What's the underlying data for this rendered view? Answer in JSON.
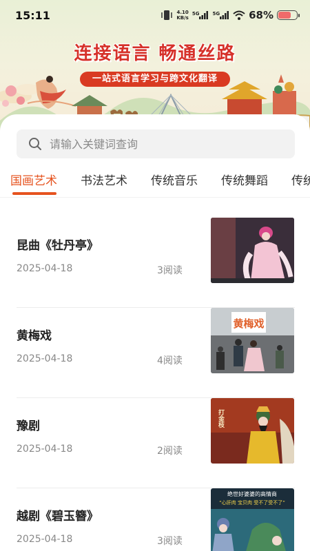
{
  "status_bar": {
    "time": "15:11",
    "net_speed_value": "4.10",
    "net_speed_unit": "KB/s",
    "signal_1_label": "5G",
    "signal_2_label": "5G",
    "battery_percent": "68%",
    "battery_level": 0.68,
    "battery_color": "#f06a6a"
  },
  "banner": {
    "slogan": "连接语言 畅通丝路",
    "subtitle": "一站式语言学习与跨文化翻译"
  },
  "search": {
    "placeholder": "请输入关键词查询"
  },
  "tabs": [
    {
      "label": "国画艺术",
      "active": true
    },
    {
      "label": "书法艺术",
      "active": false
    },
    {
      "label": "传统音乐",
      "active": false
    },
    {
      "label": "传统舞蹈",
      "active": false
    },
    {
      "label": "传统",
      "active": false
    }
  ],
  "articles": [
    {
      "title": "昆曲《牡丹亭》",
      "date": "2025-04-18",
      "reads": "3阅读"
    },
    {
      "title": "黄梅戏",
      "date": "2025-04-18",
      "reads": "4阅读"
    },
    {
      "title": "豫剧",
      "date": "2025-04-18",
      "reads": "2阅读"
    },
    {
      "title": "越剧《碧玉簪》",
      "date": "2025-04-18",
      "reads": "3阅读"
    }
  ],
  "thumbnail_text": {
    "huangmeixi_sign": "黄梅戏",
    "yuju_sign": "打金枝",
    "yueju_caption_1": "绝世好婆婆的高情商",
    "yueju_caption_2": "“心肝肉 宝贝肉 受不了受不了”"
  },
  "colors": {
    "accent": "#e6531f",
    "slogan_red": "#d6312a"
  }
}
